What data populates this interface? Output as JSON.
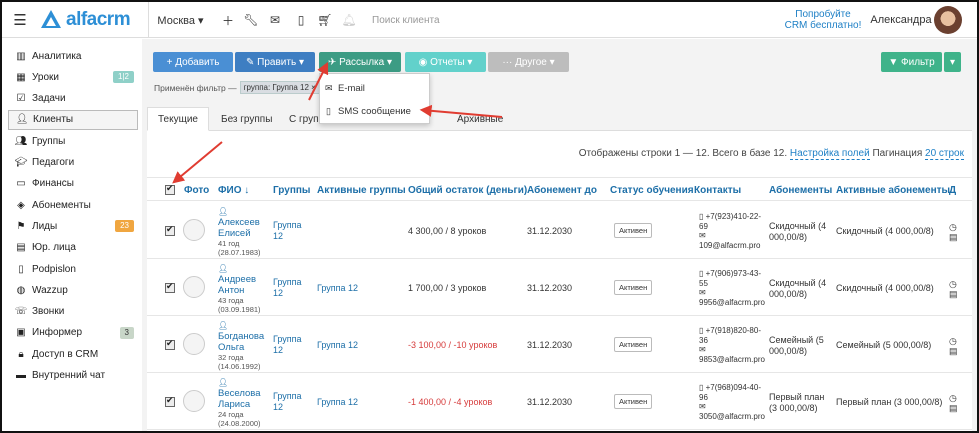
{
  "topbar": {
    "logo_text": "alfacrm",
    "city": "Москва ▾",
    "search_placeholder": "Поиск клиента",
    "try_line1": "Попробуйте",
    "try_line2": "CRM бесплатно!",
    "user_name": "Александра"
  },
  "sidebar": {
    "items": [
      {
        "label": "Аналитика",
        "icon": "chart-icon"
      },
      {
        "label": "Уроки",
        "icon": "calendar-icon",
        "badge": "1|2"
      },
      {
        "label": "Задачи",
        "icon": "tasks-icon"
      },
      {
        "label": "Клиенты",
        "icon": "user-icon"
      },
      {
        "label": "Группы",
        "icon": "group-icon"
      },
      {
        "label": "Педагоги",
        "icon": "teacher-icon"
      },
      {
        "label": "Финансы",
        "icon": "money-icon"
      },
      {
        "label": "Абонементы",
        "icon": "ticket-icon"
      },
      {
        "label": "Лиды",
        "icon": "lead-icon",
        "badge": "23"
      },
      {
        "label": "Юр. лица",
        "icon": "building-icon"
      },
      {
        "label": "Podpislon",
        "icon": "doc-icon"
      },
      {
        "label": "Wazzup",
        "icon": "whatsapp-icon"
      },
      {
        "label": "Звонки",
        "icon": "phone-icon"
      },
      {
        "label": "Информер",
        "icon": "informer-icon",
        "badge": "3"
      },
      {
        "label": "Доступ в CRM",
        "icon": "lock-icon"
      },
      {
        "label": "Внутренний чат",
        "icon": "chat-icon"
      }
    ]
  },
  "toolbar": {
    "add": "+ Добавить",
    "edit": "✎ Править ▾",
    "mailing": "✈ Рассылка ▾",
    "reports": "◉ Отчеты ▾",
    "other": "··· Другое ▾",
    "filter": "▼ Фильтр",
    "filter_caret": "▾"
  },
  "filter_note": {
    "label": "Применён фильтр —",
    "chip": "группа: Группа 12 ×"
  },
  "dropdown": {
    "email": "E-mail",
    "sms": "SMS сообщение"
  },
  "tabs": [
    "Текущие",
    "Без группы",
    "С группой",
    "Архивные"
  ],
  "pager": {
    "text": "Отображены строки 1 — 12. Всего в базе 12.",
    "settings": "Настройка полей",
    "pagination_label": "Пагинация",
    "pagination_value": "20 строк"
  },
  "columns": [
    "Фото",
    "ФИО ↓",
    "Группы",
    "Активные группы",
    "Общий остаток (деньги)",
    "Абонемент до",
    "Статус обучения",
    "Контакты",
    "Абонементы",
    "Активные абонементы",
    "Д"
  ],
  "rows": [
    {
      "name": "Алексеев Елисей",
      "age": "41 год",
      "dob": "(28.07.1983)",
      "groups": "Группа 12",
      "active_groups": "",
      "balance": "4 300,00 / 8 уроков",
      "neg": false,
      "until": "31.12.2030",
      "status": "Активен",
      "phone": "+7(923)410-22-69",
      "email": "109@alfacrm.pro",
      "subs": "Скидочный (4 000,00/8)",
      "active_subs": "Скидочный (4 000,00/8)"
    },
    {
      "name": "Андреев Антон",
      "age": "43 года",
      "dob": "(03.09.1981)",
      "groups": "Группа 12",
      "active_groups": "Группа 12",
      "balance": "1 700,00 / 3 уроков",
      "neg": false,
      "until": "31.12.2030",
      "status": "Активен",
      "phone": "+7(906)973-43-55",
      "email": "9956@alfacrm.pro",
      "subs": "Скидочный (4 000,00/8)",
      "active_subs": "Скидочный (4 000,00/8)"
    },
    {
      "name": "Богданова Ольга",
      "age": "32 года",
      "dob": "(14.06.1992)",
      "groups": "Группа 12",
      "active_groups": "Группа 12",
      "balance": "-3 100,00 / -10 уроков",
      "neg": true,
      "until": "31.12.2030",
      "status": "Активен",
      "phone": "+7(918)820-80-36",
      "email": "9853@alfacrm.pro",
      "subs": "Семейный (5 000,00/8)",
      "active_subs": "Семейный (5 000,00/8)"
    },
    {
      "name": "Веселова Лариса",
      "age": "24 года",
      "dob": "(24.08.2000)",
      "groups": "Группа 12",
      "active_groups": "Группа 12",
      "balance": "-1 400,00 / -4 уроков",
      "neg": true,
      "until": "31.12.2030",
      "status": "Активен",
      "phone": "+7(968)094-40-96",
      "email": "3050@alfacrm.pro",
      "subs": "Первый план (3 000,00/8)",
      "active_subs": "Первый план (3 000,00/8)"
    }
  ],
  "colors": {
    "add": "#4a8fd4",
    "edit": "#3e7ec2",
    "mailing": "#3c9c84",
    "reports": "#62d1cb",
    "other": "#bdbdbd",
    "filter": "#3fb38a",
    "annotation_arrow": "#e03c31"
  }
}
